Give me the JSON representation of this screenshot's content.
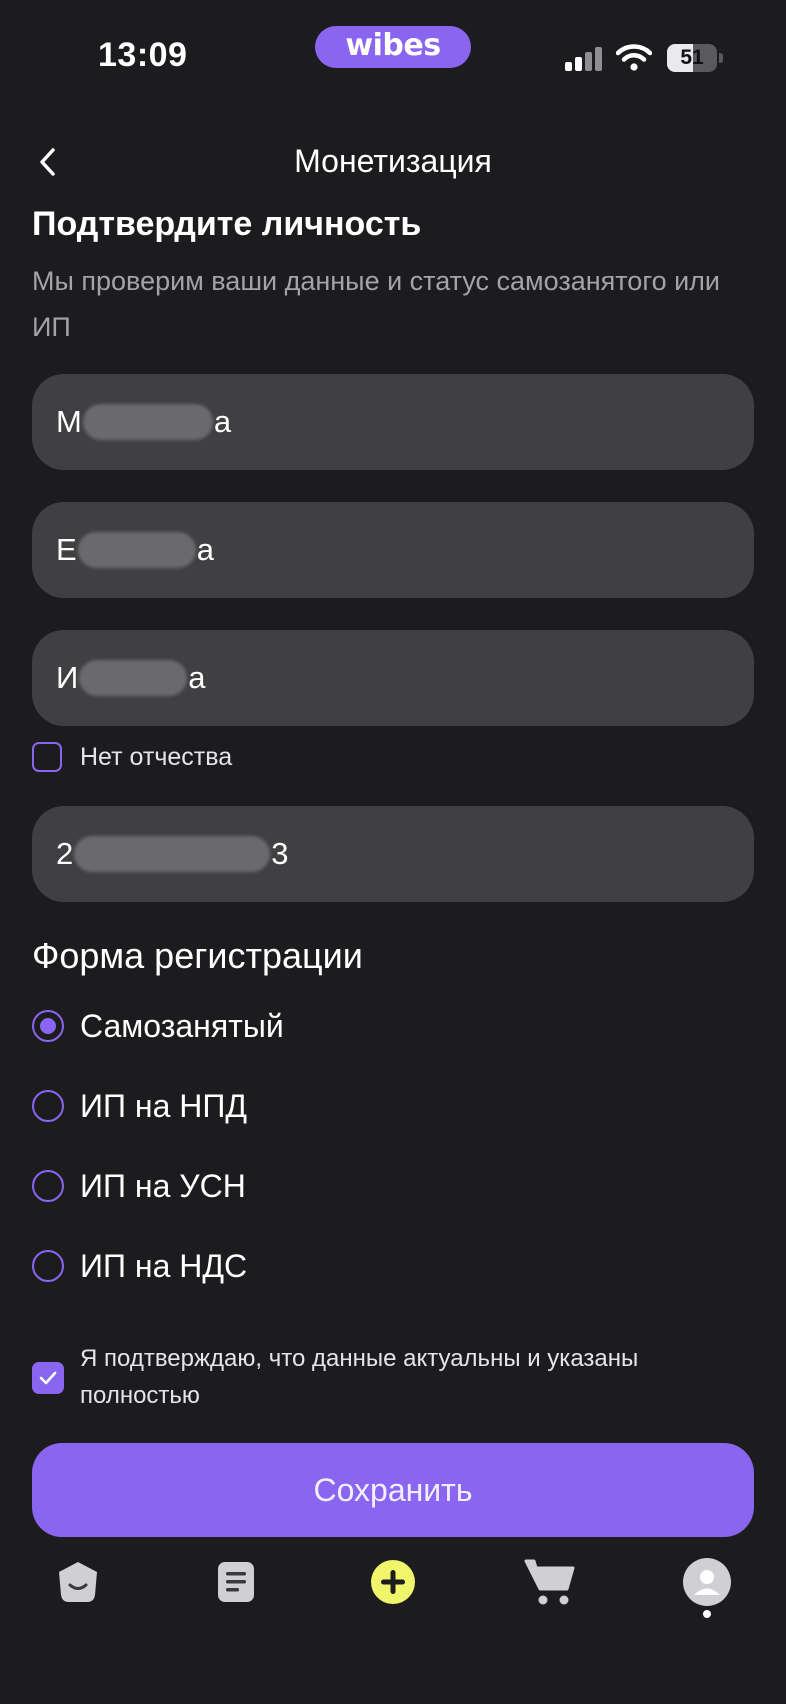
{
  "status_bar": {
    "time": "13:09",
    "brand": "wibes",
    "battery_percent": "51",
    "battery_level": 0.51,
    "signal_bars_active": 2,
    "signal_bars_total": 4
  },
  "header": {
    "title": "Монетизация",
    "back_icon": "chevron-left-icon"
  },
  "intro": {
    "heading": "Подтвердите личность",
    "subtitle": "Мы проверим ваши данные и статус самозанятого или ИП"
  },
  "form": {
    "last_name": {
      "prefix": "М",
      "suffix": "а"
    },
    "first_name": {
      "prefix": "Е",
      "suffix": "а"
    },
    "patronymic": {
      "prefix": "И",
      "suffix": "а"
    },
    "no_patronymic_label": "Нет отчества",
    "no_patronymic_checked": false,
    "inn": {
      "prefix": "2",
      "suffix": "3"
    }
  },
  "registration": {
    "title": "Форма регистрации",
    "selected": "Самозанятый",
    "options": [
      {
        "label": "Самозанятый",
        "selected": true
      },
      {
        "label": "ИП на НПД",
        "selected": false
      },
      {
        "label": "ИП на УСН",
        "selected": false
      },
      {
        "label": "ИП на НДС",
        "selected": false
      }
    ]
  },
  "confirm": {
    "text": "Я подтверждаю, что данные актуальны и указаны полностью",
    "checked": true
  },
  "save_label": "Сохранить",
  "tab_bar": {
    "items": [
      "home-icon",
      "feed-icon",
      "create-icon",
      "cart-icon",
      "profile-icon"
    ],
    "active": "profile-icon"
  },
  "colors": {
    "background": "#1c1c1e",
    "accent": "#8a66f0",
    "field": "#404042",
    "muted_text": "#a3a3a8",
    "create_button": "#f0f56b"
  }
}
